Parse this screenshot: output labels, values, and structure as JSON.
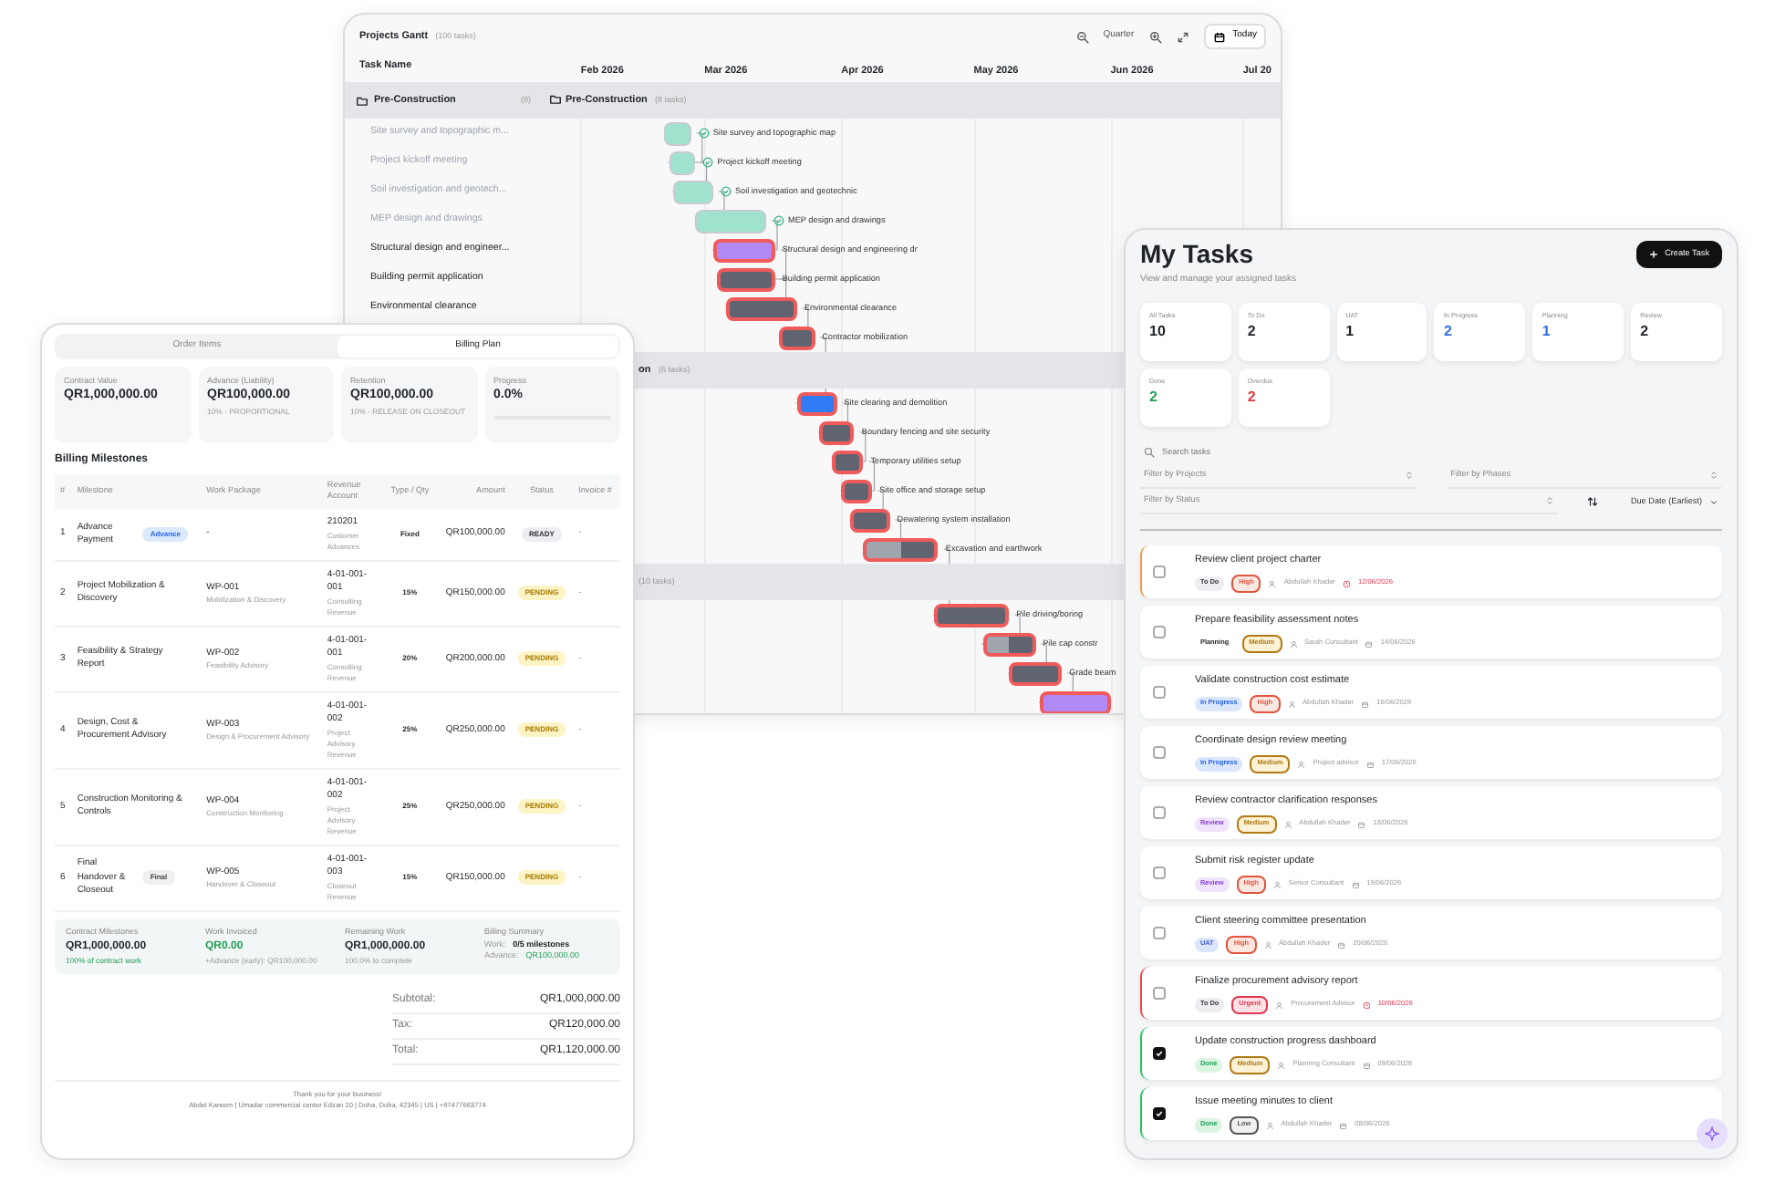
{
  "gantt": {
    "title": "Projects Gantt",
    "count": "(100 tasks)",
    "zoom_level": "Quarter",
    "today_button": "Today",
    "task_column": "Task Name",
    "months": [
      {
        "label": "Feb 2026"
      },
      {
        "label": "Mar 2026"
      },
      {
        "label": "Apr 2026"
      },
      {
        "label": "May 2026"
      },
      {
        "label": "Jun 2026"
      },
      {
        "label": "Jul 20"
      }
    ],
    "groups": [
      {
        "name": "Pre-Construction",
        "count": "(8)",
        "chart_label": "Pre-Construction",
        "chart_count": "(8 tasks)",
        "tasks": [
          {
            "name": "Site survey and topographic m...",
            "label": "Site survey and topographic map",
            "color": "#9fe3cf",
            "done": true,
            "critical": false
          },
          {
            "name": "Project kickoff meeting",
            "label": "Project kickoff meeting",
            "color": "#9fe3cf",
            "done": true,
            "critical": false
          },
          {
            "name": "Soil investigation and geotech...",
            "label": "Soil investigation and geotechnic",
            "color": "#9fe3cf",
            "done": true,
            "critical": false
          },
          {
            "name": "MEP design and drawings",
            "label": "MEP design and drawings",
            "color": "#9fe3cf",
            "done": true,
            "critical": false
          },
          {
            "name": "Structural design and engineer...",
            "label": "Structural design and engineering dr",
            "color": "#b288f6",
            "done": false,
            "critical": true
          },
          {
            "name": "Building permit application",
            "label": "Building permit application",
            "color": "#5f6470",
            "done": false,
            "critical": true
          },
          {
            "name": "Environmental clearance",
            "label": "Environmental clearance",
            "color": "#5f6470",
            "done": false,
            "critical": true
          },
          {
            "label": "Contractor mobilization",
            "color": "#5f6470",
            "done": false,
            "critical": true
          }
        ]
      },
      {
        "chart_label": "on",
        "chart_count": "(6 tasks)",
        "tasks": [
          {
            "label": "Site clearing and demolition",
            "color": "#2f7cf6",
            "done": false,
            "critical": true
          },
          {
            "label": "Boundary fencing and site security",
            "color": "#5f6470",
            "done": false,
            "critical": true
          },
          {
            "label": "Temporary utilities setup",
            "color": "#5f6470",
            "done": false,
            "critical": true
          },
          {
            "label": "Site office and storage setup",
            "color": "#5f6470",
            "done": false,
            "critical": true
          },
          {
            "label": "Dewatering system installation",
            "color": "#5f6470",
            "done": false,
            "critical": true
          },
          {
            "label": "Excavation and earthwork",
            "color": "#5f6470",
            "done": false,
            "critical": true,
            "level": 0.5
          }
        ]
      },
      {
        "chart_count": "(10 tasks)",
        "tasks": [
          {
            "label": "Pile driving/boring",
            "color": "#5f6470",
            "done": false,
            "critical": true
          },
          {
            "label": "Pile cap constr",
            "color": "#5f6470",
            "done": false,
            "critical": true,
            "level": 0.5
          },
          {
            "label": "Grade beam",
            "color": "#5f6470",
            "done": false,
            "critical": true
          },
          {
            "color": "#b288f6",
            "done": false,
            "critical": true
          }
        ]
      }
    ]
  },
  "billing": {
    "tabs": [
      {
        "label": "Order Items",
        "selected": false
      },
      {
        "label": "Billing Plan",
        "selected": true
      }
    ],
    "cards": [
      {
        "label": "Contract Value",
        "value": "QR1,000,000.00"
      },
      {
        "label": "Advance (Liability)",
        "value": "QR100,000.00",
        "note": "10% · PROPORTIONAL"
      },
      {
        "label": "Retention",
        "value": "QR100,000.00",
        "note": "10% · RELEASE ON CLOSEOUT"
      },
      {
        "label": "Progress",
        "value": "0.0%",
        "level": 0
      }
    ],
    "section_title": "Billing Milestones",
    "columns": [
      "#",
      "Milestone",
      "Work Package",
      "Revenue Account",
      "Type / Qty",
      "Amount",
      "Status",
      "Invoice #"
    ],
    "rows": [
      {
        "number": "1",
        "milestone": "Advance Payment",
        "tag": {
          "label": "Advance",
          "kind": "advance"
        },
        "wp_code": "-",
        "account_code": "210201",
        "account_name": "Customer Advances",
        "type": "Fixed",
        "amount": "QR100,000.00",
        "status": {
          "label": "READY",
          "kind": "ready"
        },
        "invoice": "-"
      },
      {
        "number": "2",
        "milestone": "Project Mobilization & Discovery",
        "wp_code": "WP-001",
        "wp_name": "Mobilization & Discovery",
        "account_code": "4-01-001-001",
        "account_name": "Consulting Revenue",
        "type": "15%",
        "amount": "QR150,000.00",
        "status": {
          "label": "PENDING",
          "kind": "pending"
        },
        "invoice": "-"
      },
      {
        "number": "3",
        "milestone": "Feasibility & Strategy Report",
        "wp_code": "WP-002",
        "wp_name": "Feasibility Advisory",
        "account_code": "4-01-001-001",
        "account_name": "Consulting Revenue",
        "type": "20%",
        "amount": "QR200,000.00",
        "status": {
          "label": "PENDING",
          "kind": "pending"
        },
        "invoice": "-"
      },
      {
        "number": "4",
        "milestone": "Design, Cost & Procurement Advisory",
        "wp_code": "WP-003",
        "wp_name": "Design & Procurement Advisory",
        "account_code": "4-01-001-002",
        "account_name": "Project Advisory Revenue",
        "type": "25%",
        "amount": "QR250,000.00",
        "status": {
          "label": "PENDING",
          "kind": "pending"
        },
        "invoice": "-"
      },
      {
        "number": "5",
        "milestone": "Construction Monitoring & Controls",
        "wp_code": "WP-004",
        "wp_name": "Construction Monitoring",
        "account_code": "4-01-001-002",
        "account_name": "Project Advisory Revenue",
        "type": "25%",
        "amount": "QR250,000.00",
        "status": {
          "label": "PENDING",
          "kind": "pending"
        },
        "invoice": "-"
      },
      {
        "number": "6",
        "milestone": "Final Handover & Closeout",
        "tag": {
          "label": "Final",
          "kind": "final"
        },
        "wp_code": "WP-005",
        "wp_name": "Handover & Closeout",
        "account_code": "4-01-001-003",
        "account_name": "Closeout Revenue",
        "type": "15%",
        "amount": "QR150,000.00",
        "status": {
          "label": "PENDING",
          "kind": "pending"
        },
        "invoice": "-"
      }
    ],
    "summary": [
      {
        "kind": "figure",
        "label": "Contract Milestones",
        "value": "QR1,000,000.00",
        "note": "100% of contract work",
        "value_positive": false,
        "note_positive": true
      },
      {
        "kind": "figure",
        "label": "Work Invoiced",
        "value": "QR0.00",
        "note": "+Advance (early): QR100,000.00",
        "value_positive": true,
        "note_positive": false
      },
      {
        "kind": "figure",
        "label": "Remaining Work",
        "value": "QR1,000,000.00",
        "note": "100.0% to complete",
        "value_positive": false,
        "note_positive": false
      },
      {
        "kind": "lines",
        "label": "Billing Summary",
        "work_label": "Work:",
        "work_count": "0/5 milestones",
        "advance_label": "Advance:",
        "advance_value": "QR100,000.00"
      }
    ],
    "totals": [
      {
        "label": "Subtotal:",
        "value": "QR1,000,000.00"
      },
      {
        "label": "Tax:",
        "value": "QR120,000.00"
      },
      {
        "label": "Total:",
        "value": "QR1,120,000.00"
      }
    ],
    "footer": {
      "thanks": "Thank you for your business!",
      "address": "Abdel Kareem | Umadar commercial center Edzan 10 | Doha, Doha, 42345 | US | +97477663774"
    }
  },
  "tasks": {
    "title": "My Tasks",
    "subtitle": "View and manage your assigned tasks",
    "create_button": "Create Task",
    "stats": [
      {
        "label": "All Tasks",
        "value": "10",
        "color": "#1f2328"
      },
      {
        "label": "To Do",
        "value": "2",
        "color": "#1f2328"
      },
      {
        "label": "UAT",
        "value": "1",
        "color": "#1f2328"
      },
      {
        "label": "In Progress",
        "value": "2",
        "color": "#2f6fe0"
      },
      {
        "label": "Planning",
        "value": "1",
        "color": "#2f6fe0"
      },
      {
        "label": "Review",
        "value": "2",
        "color": "#1f2328"
      },
      {
        "label": "Done",
        "value": "2",
        "color": "#1f9d55"
      },
      {
        "label": "Overdue",
        "value": "2",
        "color": "#e03a3a"
      }
    ],
    "search": {
      "placeholder": "Search tasks"
    },
    "filters": [
      "Filter by Projects",
      "Filter by Phases",
      "Filter by Status"
    ],
    "sort": "Due Date (Earliest)",
    "items": [
      {
        "title": "Review client project charter",
        "status": {
          "label": "To Do",
          "kind": "todo"
        },
        "priority": {
          "label": "High",
          "kind": "high"
        },
        "assignee": "Abdullah Khader",
        "due": "12/06/2026",
        "overdue": true,
        "checked": false,
        "color": "#f59b4c"
      },
      {
        "title": "Prepare feasibility assessment notes",
        "status": {
          "label": "Planning",
          "kind": "planning"
        },
        "priority": {
          "label": "Medium",
          "kind": "medium"
        },
        "assignee": "Sarah Consultant",
        "due": "14/06/2026",
        "overdue": false,
        "checked": false
      },
      {
        "title": "Validate construction cost estimate",
        "status": {
          "label": "In Progress",
          "kind": "progress"
        },
        "priority": {
          "label": "High",
          "kind": "high"
        },
        "assignee": "Abdullah Khader",
        "due": "16/06/2026",
        "overdue": false,
        "checked": false
      },
      {
        "title": "Coordinate design review meeting",
        "status": {
          "label": "In Progress",
          "kind": "progress"
        },
        "priority": {
          "label": "Medium",
          "kind": "medium"
        },
        "assignee": "Project advisor",
        "due": "17/06/2026",
        "overdue": false,
        "checked": false
      },
      {
        "title": "Review contractor clarification responses",
        "status": {
          "label": "Review",
          "kind": "review"
        },
        "priority": {
          "label": "Medium",
          "kind": "medium"
        },
        "assignee": "Abdullah Khader",
        "due": "18/06/2026",
        "overdue": false,
        "checked": false
      },
      {
        "title": "Submit risk register update",
        "status": {
          "label": "Review",
          "kind": "review"
        },
        "priority": {
          "label": "High",
          "kind": "high"
        },
        "assignee": "Senior Consultant",
        "due": "19/06/2026",
        "overdue": false,
        "checked": false
      },
      {
        "title": "Client steering committee presentation",
        "status": {
          "label": "UAT",
          "kind": "uat"
        },
        "priority": {
          "label": "High",
          "kind": "high"
        },
        "assignee": "Abdullah Khader",
        "due": "20/06/2026",
        "overdue": false,
        "checked": false
      },
      {
        "title": "Finalize procurement advisory report",
        "status": {
          "label": "To Do",
          "kind": "todo"
        },
        "priority": {
          "label": "Urgent",
          "kind": "urgent"
        },
        "assignee": "Procurement Advisor",
        "due": "10/06/2026",
        "overdue": true,
        "checked": false,
        "color": "#ef4444"
      },
      {
        "title": "Update construction progress dashboard",
        "status": {
          "label": "Done",
          "kind": "done"
        },
        "priority": {
          "label": "Medium",
          "kind": "medium"
        },
        "assignee": "Planning Consultant",
        "due": "09/06/2026",
        "overdue": false,
        "checked": true,
        "color": "#22c55e"
      },
      {
        "title": "Issue meeting minutes to client",
        "status": {
          "label": "Done",
          "kind": "done"
        },
        "priority": {
          "label": "Low",
          "kind": "low"
        },
        "assignee": "Abdullah Khader",
        "due": "08/06/2026",
        "overdue": false,
        "checked": true,
        "color": "#22c55e"
      }
    ]
  }
}
